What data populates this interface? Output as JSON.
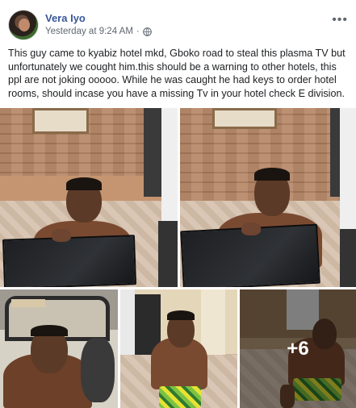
{
  "post": {
    "author": "Vera Iyo",
    "timestamp": "Yesterday at 9:24 AM",
    "separator": "·",
    "text": "This guy came to kyabiz hotel mkd, Gboko road to steal this plasma TV but unfortunately we cought him.this should be a warning to other hotels, this ppl are not joking ooooo. While he was caught he had keys to order hotel rooms, should incase you have a missing Tv in your hotel check E division.",
    "more_photos_count": "+6"
  },
  "icons": {
    "privacy": "globe-icon",
    "menu": "more-options-icon"
  },
  "colors": {
    "author_link": "#385898",
    "meta_text": "#606770",
    "body_text": "#1c1e21"
  }
}
